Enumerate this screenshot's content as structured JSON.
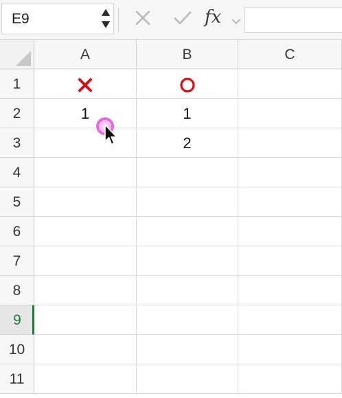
{
  "formula_bar": {
    "name_box": "E9",
    "fx_label": "fx",
    "formula_value": ""
  },
  "sheet": {
    "columns": [
      "A",
      "B",
      "C"
    ],
    "rows": [
      "1",
      "2",
      "3",
      "4",
      "5",
      "6",
      "7",
      "8",
      "9",
      "10",
      "11"
    ],
    "active_row": "9",
    "cells": {
      "A1": {
        "icon": "cross-mark-icon",
        "color": "#d0111b"
      },
      "B1": {
        "icon": "circle-mark-icon",
        "color": "#d0111b"
      },
      "A2": "1",
      "B2": "1",
      "B3": "2"
    }
  },
  "colors": {
    "mark_red": "#d0111b",
    "active_green": "#1f7a3a",
    "click_ring": "#e05cd6"
  }
}
